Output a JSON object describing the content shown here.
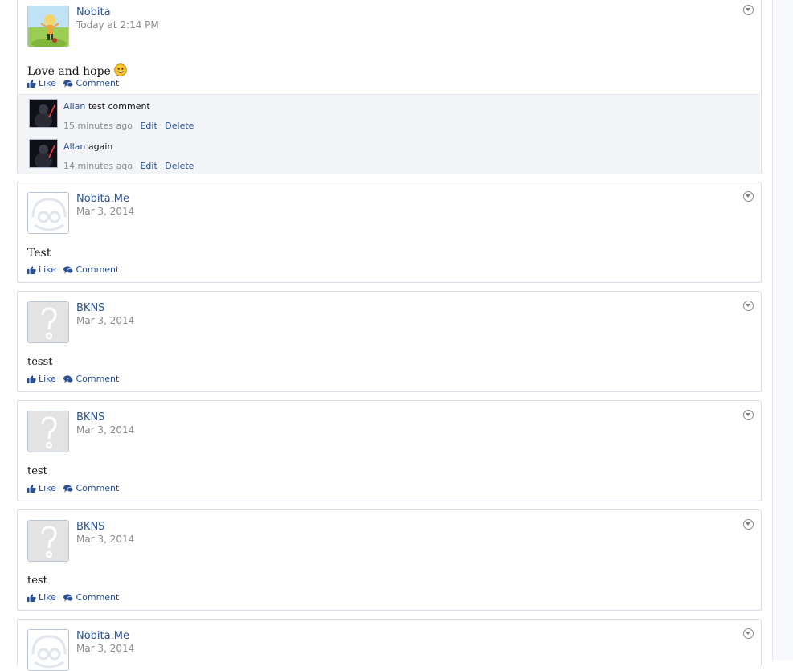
{
  "posts": [
    {
      "username": "Nobita",
      "date": "Today at 2:14 PM",
      "message": "Love and hope",
      "message_icon": "smiley-emoji",
      "avatar": "cartoon-character",
      "like_label": "Like",
      "comment_label": "Comment",
      "comments": [
        {
          "username": "Allan",
          "text": "test comment",
          "time": "15 minutes ago",
          "edit": "Edit",
          "delete": "Delete"
        },
        {
          "username": "Allan",
          "text": "again",
          "time": "14 minutes ago",
          "edit": "Edit",
          "delete": "Delete"
        }
      ]
    },
    {
      "username": "Nobita.Me",
      "date": "Mar 3, 2014",
      "message": "Test",
      "avatar": "face-placeholder",
      "like_label": "Like",
      "comment_label": "Comment"
    },
    {
      "username": "BKNS",
      "date": "Mar 3, 2014",
      "message": "tesst",
      "avatar": "question-mark",
      "like_label": "Like",
      "comment_label": "Comment"
    },
    {
      "username": "BKNS",
      "date": "Mar 3, 2014",
      "message": "test",
      "avatar": "question-mark",
      "like_label": "Like",
      "comment_label": "Comment"
    },
    {
      "username": "BKNS",
      "date": "Mar 3, 2014",
      "message": "test",
      "avatar": "question-mark",
      "like_label": "Like",
      "comment_label": "Comment"
    },
    {
      "username": "Nobita.Me",
      "date": "Mar 3, 2014",
      "avatar": "face-placeholder"
    }
  ],
  "colors": {
    "link": "#2a5294",
    "muted": "#8a8a8a",
    "card_border": "#d7dde6",
    "comment_bg": "#f2f4f8"
  }
}
